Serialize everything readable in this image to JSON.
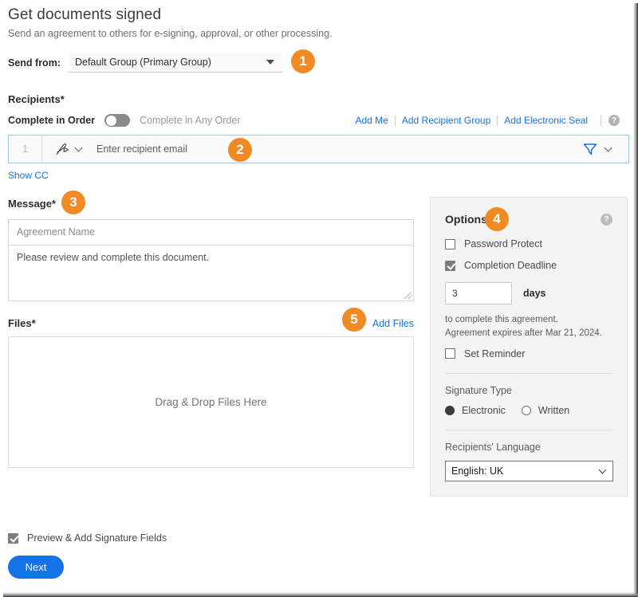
{
  "header": {
    "title": "Get documents signed",
    "subtitle": "Send an agreement to others for e-signing, approval, or other processing."
  },
  "send_from": {
    "label": "Send from:",
    "value": "Default Group (Primary Group)",
    "badge": "1"
  },
  "recipients": {
    "section_label": "Recipients",
    "required_mark": "*",
    "order_label": "Complete in Order",
    "order_alt_label": "Complete in Any Order",
    "toggle_on": false,
    "links": [
      "Add Me",
      "Add Recipient Group",
      "Add Electronic Seal"
    ],
    "help_glyph": "?",
    "row": {
      "index": "1",
      "placeholder": "Enter recipient email",
      "role_icon": "pen-signature-icon",
      "delivery_icon": "filter-delivery-icon",
      "badge": "2"
    },
    "show_cc": "Show CC"
  },
  "message": {
    "section_label": "Message",
    "required_mark": "*",
    "badge": "3",
    "agreement_name_placeholder": "Agreement Name",
    "body_value": "Please review and complete this document."
  },
  "files": {
    "section_label": "Files",
    "required_mark": "*",
    "badge": "5",
    "add_files_label": "Add Files",
    "dropzone_text": "Drag & Drop Files Here"
  },
  "options": {
    "title": "Options",
    "badge": "4",
    "help_glyph": "?",
    "password_protect": {
      "label": "Password Protect",
      "checked": false
    },
    "completion_deadline": {
      "label": "Completion Deadline",
      "checked": true
    },
    "days_value": "3",
    "days_word": "days",
    "note_line1": "to complete this agreement.",
    "note_line2": "Agreement expires after Mar 21, 2024.",
    "set_reminder": {
      "label": "Set Reminder",
      "checked": false
    },
    "signature_type_title": "Signature Type",
    "signature_options": [
      {
        "label": "Electronic",
        "selected": true
      },
      {
        "label": "Written",
        "selected": false
      }
    ],
    "language_title": "Recipients' Language",
    "language_value": "English: UK"
  },
  "footer": {
    "preview_label": "Preview & Add Signature Fields",
    "preview_checked": true,
    "next_label": "Next"
  },
  "colors": {
    "accent_orange": "#ef8b22",
    "link_blue": "#1473e6",
    "panel_gray": "#f4f4f4"
  }
}
